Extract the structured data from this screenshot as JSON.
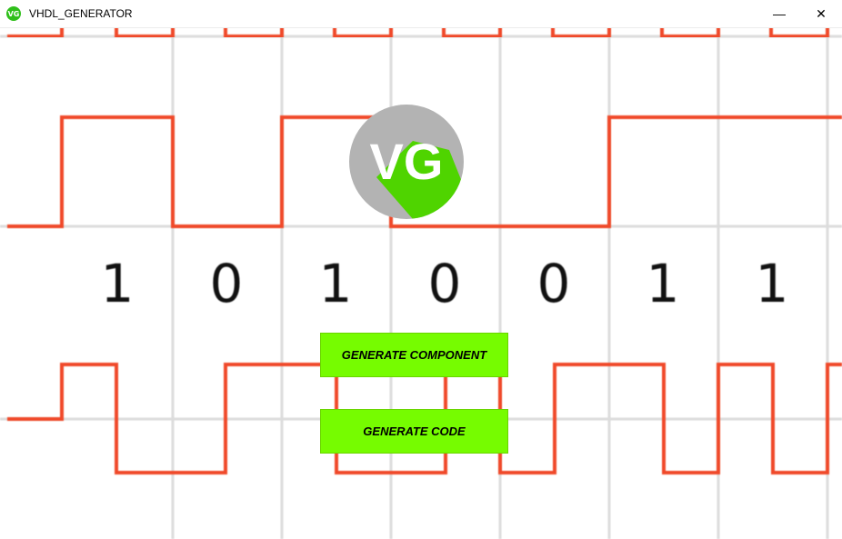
{
  "window": {
    "title": "VHDL_GENERATOR",
    "icon_text": "VG",
    "minimize_glyph": "—",
    "close_glyph": "✕"
  },
  "logo": {
    "text": "VG",
    "circle_color": "#b3b3b3",
    "shadow_color": "#4fd400"
  },
  "bits": [
    "1",
    "0",
    "1",
    "0",
    "0",
    "1",
    "1"
  ],
  "buttons": {
    "generate_component": "GENERATE COMPONENT",
    "generate_code": "GENERATE CODE"
  },
  "colors": {
    "wave": "#f04a2a",
    "grid": "#dcdcdc",
    "button": "#76fc00"
  }
}
